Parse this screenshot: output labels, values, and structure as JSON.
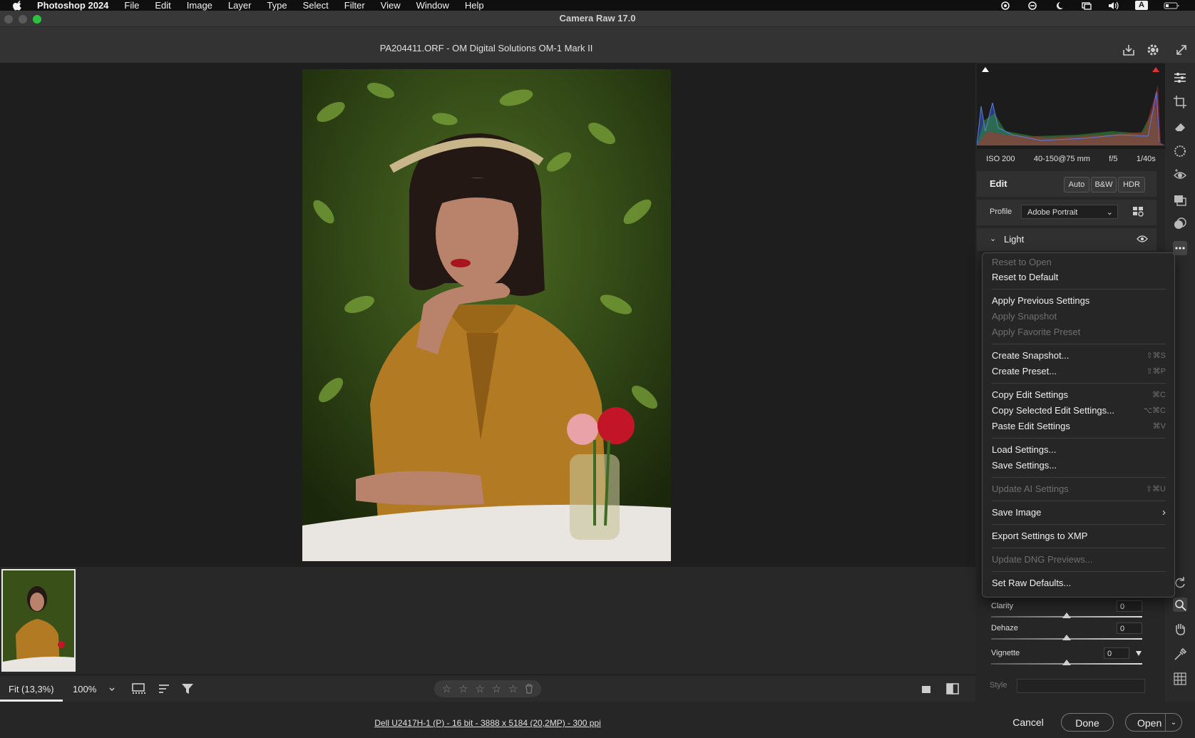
{
  "menubar": {
    "app_name": "Photoshop 2024",
    "items": [
      "File",
      "Edit",
      "Image",
      "Layer",
      "Type",
      "Select",
      "Filter",
      "View",
      "Window",
      "Help"
    ],
    "input_source": "A"
  },
  "window": {
    "title": "Camera Raw 17.0"
  },
  "header": {
    "file_title": "PA204411.ORF  -  OM Digital Solutions OM-1 Mark II"
  },
  "histogram": {
    "exif": [
      "ISO 200",
      "40-150@75 mm",
      "f/5",
      "1/40s"
    ]
  },
  "edit_panel": {
    "title": "Edit",
    "auto_label": "Auto",
    "bw_label": "B&W",
    "hdr_label": "HDR",
    "profile_label": "Profile",
    "profile_value": "Adobe Portrait",
    "section_light": "Light"
  },
  "sliders": [
    {
      "label": "Clarity",
      "value": "0",
      "position": 0.5
    },
    {
      "label": "Dehaze",
      "value": "0",
      "position": 0.5
    },
    {
      "label": "Vignette",
      "value": "0",
      "position": 0.5
    }
  ],
  "style_label": "Style",
  "context_menu": {
    "items": [
      {
        "label": "Reset to Open",
        "disabled": true,
        "shortcut": ""
      },
      {
        "label": "Reset to Default",
        "disabled": false,
        "shortcut": ""
      },
      {
        "label": "Apply Previous Settings",
        "disabled": false,
        "shortcut": ""
      },
      {
        "label": "Apply Snapshot",
        "disabled": true,
        "shortcut": ""
      },
      {
        "label": "Apply Favorite Preset",
        "disabled": true,
        "shortcut": ""
      },
      {
        "label": "Create Snapshot...",
        "disabled": false,
        "shortcut": "⇧⌘S"
      },
      {
        "label": "Create Preset...",
        "disabled": false,
        "shortcut": "⇧⌘P"
      },
      {
        "label": "Copy Edit Settings",
        "disabled": false,
        "shortcut": "⌘C"
      },
      {
        "label": "Copy Selected Edit Settings...",
        "disabled": false,
        "shortcut": "⌥⌘C"
      },
      {
        "label": "Paste Edit Settings",
        "disabled": false,
        "shortcut": "⌘V"
      },
      {
        "label": "Load Settings...",
        "disabled": false,
        "shortcut": ""
      },
      {
        "label": "Save Settings...",
        "disabled": false,
        "shortcut": ""
      },
      {
        "label": "Update AI Settings",
        "disabled": true,
        "shortcut": "⇧⌘U"
      },
      {
        "label": "Save Image",
        "disabled": false,
        "shortcut": "›"
      },
      {
        "label": "Export Settings to XMP",
        "disabled": false,
        "shortcut": ""
      },
      {
        "label": "Update DNG Previews...",
        "disabled": true,
        "shortcut": ""
      },
      {
        "label": "Set Raw Defaults...",
        "disabled": false,
        "shortcut": ""
      }
    ]
  },
  "bottom_toolbar": {
    "fit_label": "Fit (13,3%)",
    "zoom_label": "100%",
    "stars": [
      "☆",
      "☆",
      "☆",
      "☆",
      "☆"
    ]
  },
  "status": {
    "image_info": "Dell U2417H-1 (P) - 16 bit - 3888 x 5184 (20,2MP) - 300 ppi",
    "cancel_label": "Cancel",
    "done_label": "Done",
    "open_label": "Open"
  }
}
